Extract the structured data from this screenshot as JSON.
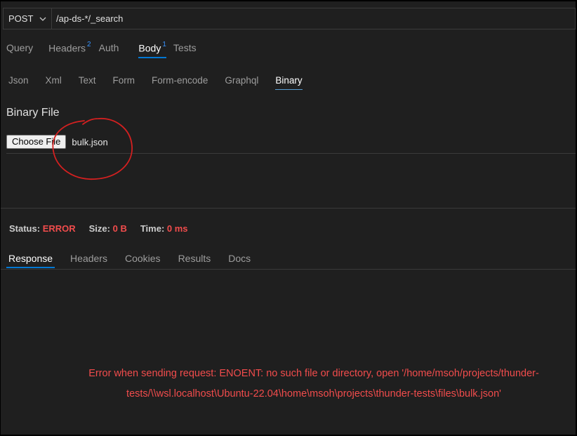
{
  "request": {
    "method": "POST",
    "url": "/ap-ds-*/_search"
  },
  "request_tabs": [
    {
      "label": "Query",
      "badge": ""
    },
    {
      "label": "Headers",
      "badge": "2"
    },
    {
      "label": "Auth",
      "badge": ""
    },
    {
      "label": "Body",
      "badge": "1"
    },
    {
      "label": "Tests",
      "badge": ""
    }
  ],
  "body_tabs": [
    "Json",
    "Xml",
    "Text",
    "Form",
    "Form-encode",
    "Graphql",
    "Binary"
  ],
  "binary": {
    "title": "Binary File",
    "choose_label": "Choose File",
    "file_name": "bulk.json"
  },
  "status": {
    "status_label": "Status:",
    "status_value": "ERROR",
    "size_label": "Size:",
    "size_value": "0 B",
    "time_label": "Time:",
    "time_value": "0 ms"
  },
  "response_tabs": [
    "Response",
    "Headers",
    "Cookies",
    "Results",
    "Docs"
  ],
  "error": {
    "line1": "Error when sending request: ENOENT: no such file or directory, open '/home/msoh/projects/thunder-",
    "line2": "tests/\\\\wsl.localhost\\Ubuntu-22.04\\home\\msoh\\projects\\thunder-tests\\files\\bulk.json'"
  },
  "colors": {
    "background": "#1f1f1f",
    "accent": "#0078d4",
    "error": "#f14c4c",
    "annotation": "#d42020"
  }
}
